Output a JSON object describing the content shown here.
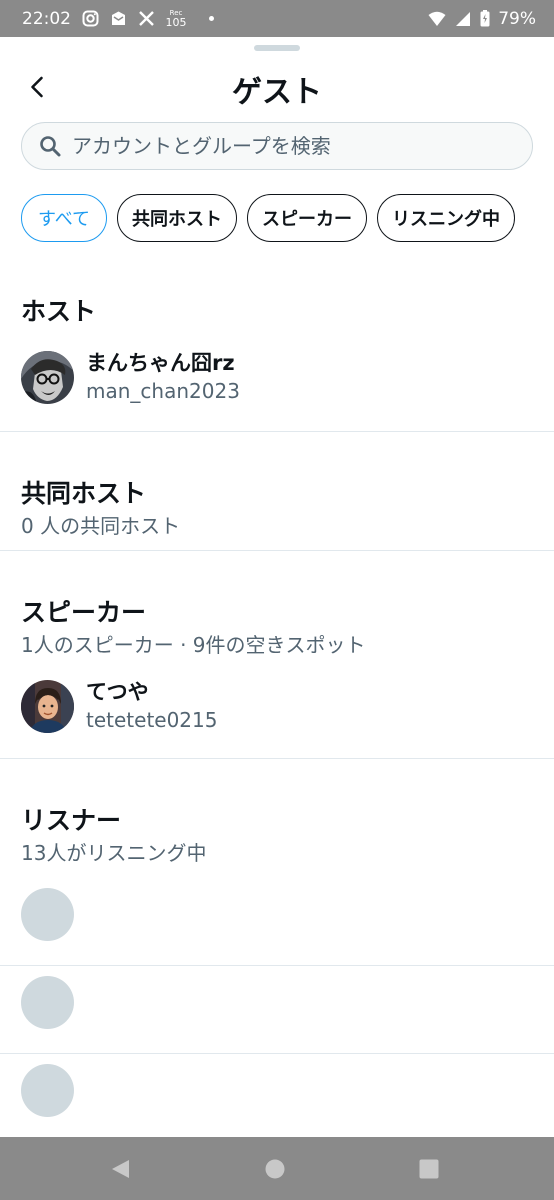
{
  "status_bar": {
    "time": "22:02",
    "notif_small_top": "Rec",
    "notif_small_bottom": "105",
    "battery": "79%",
    "icons": [
      "instagram-icon",
      "mail-icon",
      "x-icon",
      "wifi-icon",
      "signal-icon",
      "battery-icon"
    ]
  },
  "header": {
    "title": "ゲスト",
    "back_icon": "back-chevron-icon"
  },
  "search": {
    "placeholder": "アカウントとグループを検索",
    "icon": "search-icon"
  },
  "filters": [
    {
      "label": "すべて",
      "active": true
    },
    {
      "label": "共同ホスト",
      "active": false
    },
    {
      "label": "スピーカー",
      "active": false
    },
    {
      "label": "リスニング中",
      "active": false
    }
  ],
  "sections": {
    "host": {
      "title": "ホスト",
      "users": [
        {
          "name": "まんちゃん囧rz",
          "handle": "man_chan2023"
        }
      ]
    },
    "cohost": {
      "title": "共同ホスト",
      "subtitle": "0 人の共同ホスト"
    },
    "speaker": {
      "title": "スピーカー",
      "subtitle": "1人のスピーカー · 9件の空きスポット",
      "users": [
        {
          "name": "てつや",
          "handle": "tetetete0215"
        }
      ]
    },
    "listener": {
      "title": "リスナー",
      "subtitle": "13人がリスニング中"
    }
  },
  "colors": {
    "accent": "#1d9bf0",
    "text_primary": "#0f1419",
    "text_secondary": "#536471",
    "placeholder_avatar": "#cfd9de",
    "system_bar": "#8a8a8a"
  },
  "nav_bar": {
    "icons": [
      "nav-back-icon",
      "nav-home-icon",
      "nav-recents-icon"
    ]
  }
}
